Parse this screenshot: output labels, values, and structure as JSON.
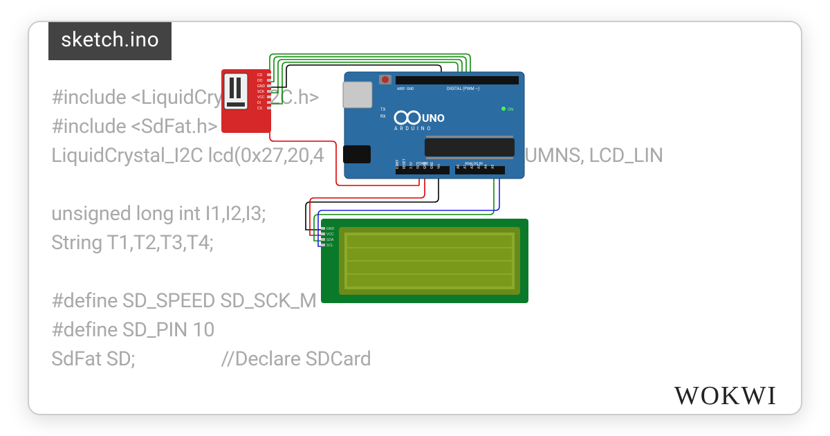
{
  "tab": {
    "filename": "sketch.ino"
  },
  "code": {
    "line1": "#include <LiquidCrystal_I2C.h>",
    "line2": "#include <SdFat.h>",
    "line3": "LiquidCrystal_I2C lcd(0x27,20,4                         LCD_COLUMNS, LCD_LIN",
    "line4": "",
    "line5": "unsigned long int I1,I2,I3;",
    "line6": "String T1,T2,T3,T4;",
    "line7": "",
    "line8": "#define SD_SPEED SD_SCK_M",
    "line9": "#define SD_PIN 10",
    "line10": "SdFat SD;                  //Declare SDCard"
  },
  "brand": "WOKWI",
  "arduino": {
    "board_label": "UNO",
    "brand_label": "A R D U I N O",
    "digital_label": "DIGITAL (PWM ~)",
    "power_label": "POWER",
    "analog_label": "ANALOG IN",
    "pins_power": [
      "IOREF",
      "RESET",
      "3.3V",
      "5V",
      "GND",
      "GND",
      "Vin"
    ],
    "pins_analog": [
      "A0",
      "A1",
      "A2",
      "A3",
      "A4",
      "A5"
    ],
    "tx": "TX",
    "rx": "RX",
    "on": "ON",
    "aref": "AREF",
    "gnd": "GND"
  },
  "sd": {
    "pins": [
      "CD",
      "DO",
      "GND",
      "SCK",
      "VCC",
      "DI",
      "CS"
    ]
  },
  "lcd": {
    "pins": [
      "GND",
      "VCC",
      "SDA",
      "SCL"
    ]
  }
}
